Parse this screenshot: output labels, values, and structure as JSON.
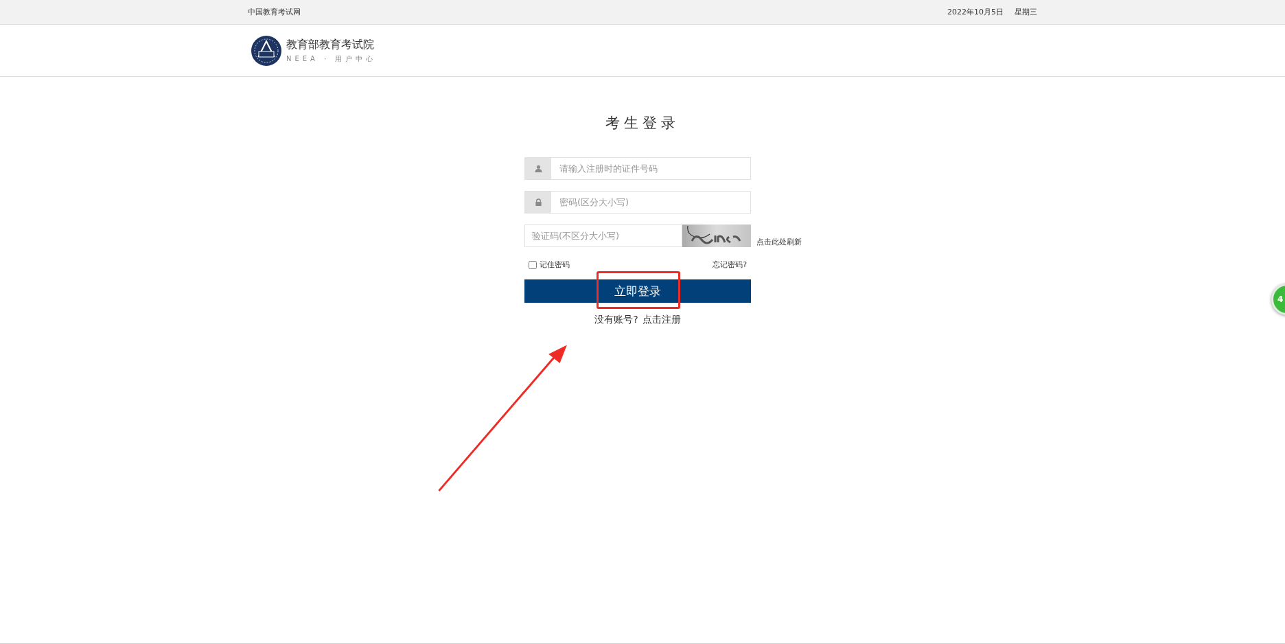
{
  "top_bar": {
    "site_name": "中国教育考试网",
    "date": "2022年10月5日",
    "weekday": "星期三"
  },
  "header": {
    "org_name": "教育部教育考试院",
    "subtitle": "NEEA · 用户中心"
  },
  "login": {
    "title": "考生登录",
    "fields": [
      {
        "kind": "id",
        "placeholder": "请输入注册时的证件号码"
      },
      {
        "kind": "password",
        "placeholder": "密码(区分大小写)"
      },
      {
        "kind": "captcha",
        "placeholder": "验证码(不区分大小写)",
        "refresh": "点击此处刷新"
      }
    ],
    "remember": {
      "label": "记住密码",
      "checked": false
    },
    "forgot": "忘记密码?",
    "submit": "立即登录",
    "register_prompt": "没有账号?",
    "register_link": "点击注册"
  },
  "side_badge": {
    "text": "4"
  }
}
